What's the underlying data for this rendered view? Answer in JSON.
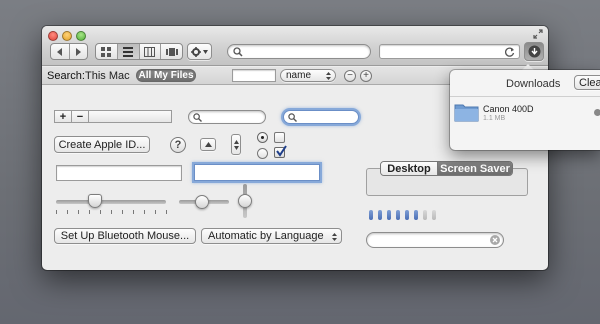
{
  "toolbar": {
    "search_placeholder": "",
    "url_value": ""
  },
  "scope_bar": {
    "label": "Search:",
    "this_mac": "This Mac",
    "all_my_files": "All My Files",
    "sort_value": "name"
  },
  "buttons": {
    "plus": "+",
    "minus": "−",
    "create_apple_id": "Create Apple ID...",
    "help": "?",
    "bluetooth": "Set Up Bluetooth Mouse...",
    "language": "Automatic by Language"
  },
  "tabs": {
    "desktop": "Desktop",
    "screen_saver": "Screen Saver"
  },
  "downloads": {
    "title": "Downloads",
    "clear": "Clea",
    "file_name": "Canon 400D",
    "file_size": "1.1 MB"
  },
  "controls": {
    "horizontal_slider_level": 0.35,
    "small_slider_level": 0.45,
    "vertical_slider_level": 0.5,
    "level_indicator_filled": 6,
    "level_indicator_total": 8,
    "radio_top_selected": true,
    "checkbox_bottom_checked": true
  },
  "colors": {
    "accent": "#5b7fc2",
    "focus_ring": "#87a9d9"
  }
}
